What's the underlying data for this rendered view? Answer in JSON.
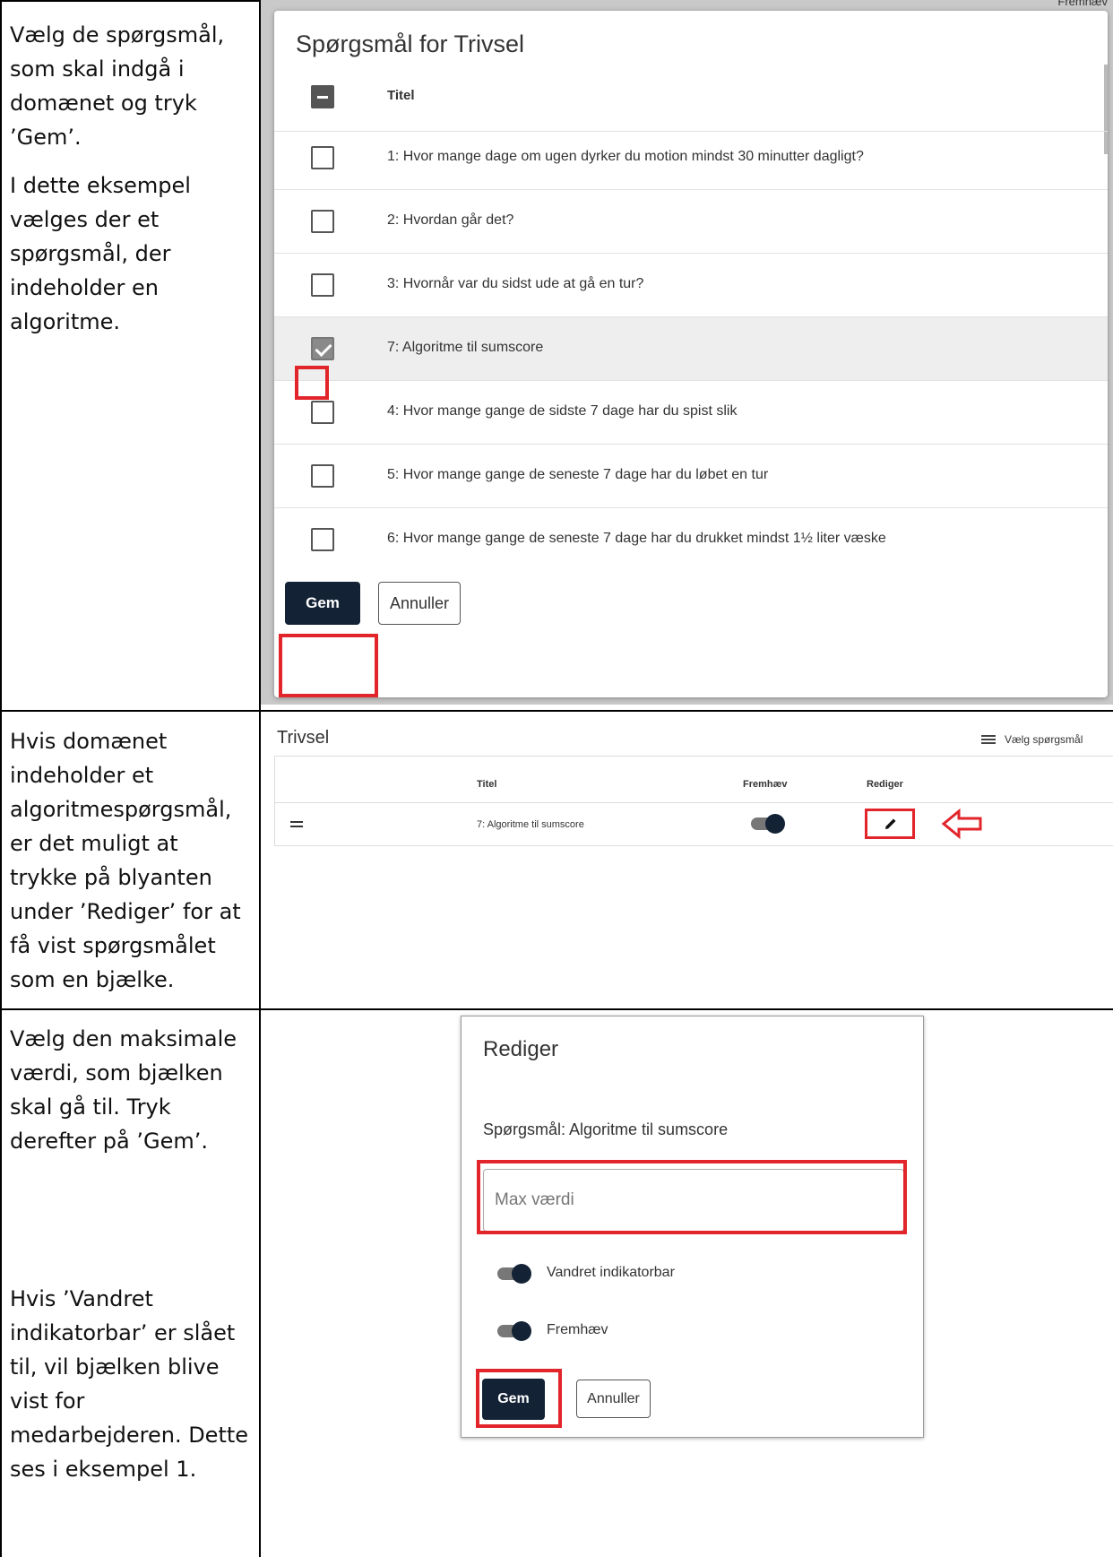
{
  "doc": {
    "row1_text1": "Vælg de spørgsmål, som skal indgå i domænet og tryk ’Gem’.",
    "row1_text2": "I dette eksempel vælges der et spørgsmål, der indeholder en algoritme.",
    "row2_text": "Hvis domænet indeholder et algoritmespørgsmål, er det muligt at trykke på blyanten under ’Rediger’ for at få vist spørgsmålet som en bjælke.",
    "row3_text1": "Vælg den maksimale værdi, som bjælken skal gå til. Tryk derefter på ’Gem’.",
    "row3_text2": "Hvis ’Vandret indikatorbar’ er slået til, vil bjælken blive vist for medarbejderen. Dette ses i eksempel 1."
  },
  "dialog1": {
    "top_note": "Fremhæv",
    "title": "Spørgsmål for Trivsel",
    "header": "Titel",
    "rows": [
      {
        "label": "1: Hvor mange dage om ugen dyrker du motion mindst 30 minutter dagligt?",
        "checked": false
      },
      {
        "label": "2: Hvordan går det?",
        "checked": false
      },
      {
        "label": "3: Hvornår var du sidst ude at gå en tur?",
        "checked": false
      },
      {
        "label": "7: Algoritme til sumscore",
        "checked": true
      },
      {
        "label": "4: Hvor mange gange de sidste 7 dage har du spist slik",
        "checked": false
      },
      {
        "label": "5: Hvor mange gange de seneste 7 dage har du løbet en tur",
        "checked": false
      },
      {
        "label": "6: Hvor mange gange de seneste 7 dage har du drukket mindst 1½ liter væske",
        "checked": false
      }
    ],
    "save": "Gem",
    "cancel": "Annuller"
  },
  "domain": {
    "title": "Trivsel",
    "choose": "Vælg spørgsmål",
    "col_title": "Titel",
    "col_highlight": "Fremhæv",
    "col_edit": "Rediger",
    "row_title": "7: Algoritme til sumscore"
  },
  "edit": {
    "title": "Rediger",
    "question": "Spørgsmål: Algoritme til sumscore",
    "max_placeholder": "Max værdi",
    "toggle1": "Vandret indikatorbar",
    "toggle2": "Fremhæv",
    "save": "Gem",
    "cancel": "Annuller"
  },
  "colors": {
    "accent_red": "#e2252b",
    "button_dark": "#132235"
  }
}
